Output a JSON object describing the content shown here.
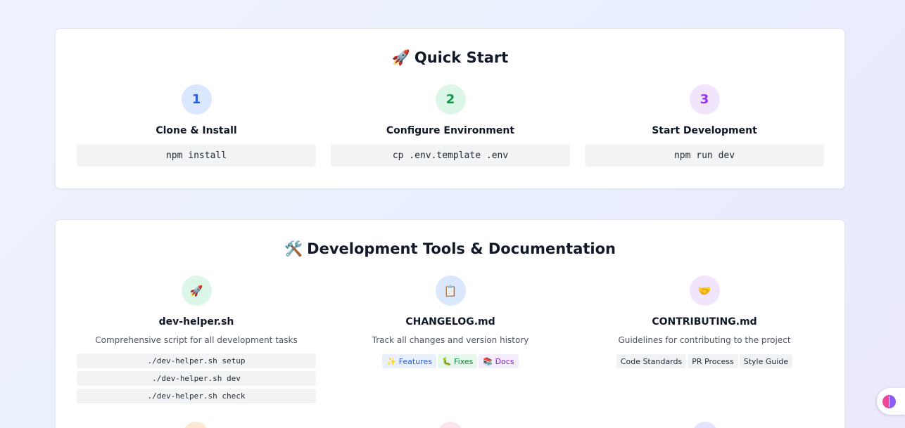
{
  "quick_start": {
    "emoji": "🚀",
    "title": "Quick Start",
    "steps": [
      {
        "number": "1",
        "title": "Clone & Install",
        "command": "npm install"
      },
      {
        "number": "2",
        "title": "Configure Environment",
        "command": "cp .env.template .env"
      },
      {
        "number": "3",
        "title": "Start Development",
        "command": "npm run dev"
      }
    ]
  },
  "dev_tools": {
    "emoji": "🛠️",
    "title": "Development Tools & Documentation",
    "tools": [
      {
        "icon": "🚀",
        "title": "dev-helper.sh",
        "description": "Comprehensive script for all development tasks",
        "commands": [
          "./dev-helper.sh setup",
          "./dev-helper.sh dev",
          "./dev-helper.sh check"
        ]
      },
      {
        "icon": "📋",
        "title": "CHANGELOG.md",
        "description": "Track all changes and version history",
        "tags": [
          "✨ Features",
          "🐛 Fixes",
          "📚 Docs"
        ]
      },
      {
        "icon": "🤝",
        "title": "CONTRIBUTING.md",
        "description": "Guidelines for contributing to the project",
        "tags": [
          "Code Standards",
          "PR Process",
          "Style Guide"
        ]
      }
    ]
  },
  "colors": {
    "step1": "#2f5fd8",
    "step2": "#15954a",
    "step3": "#9333ea"
  },
  "fab": {
    "icon": "brain-icon"
  }
}
